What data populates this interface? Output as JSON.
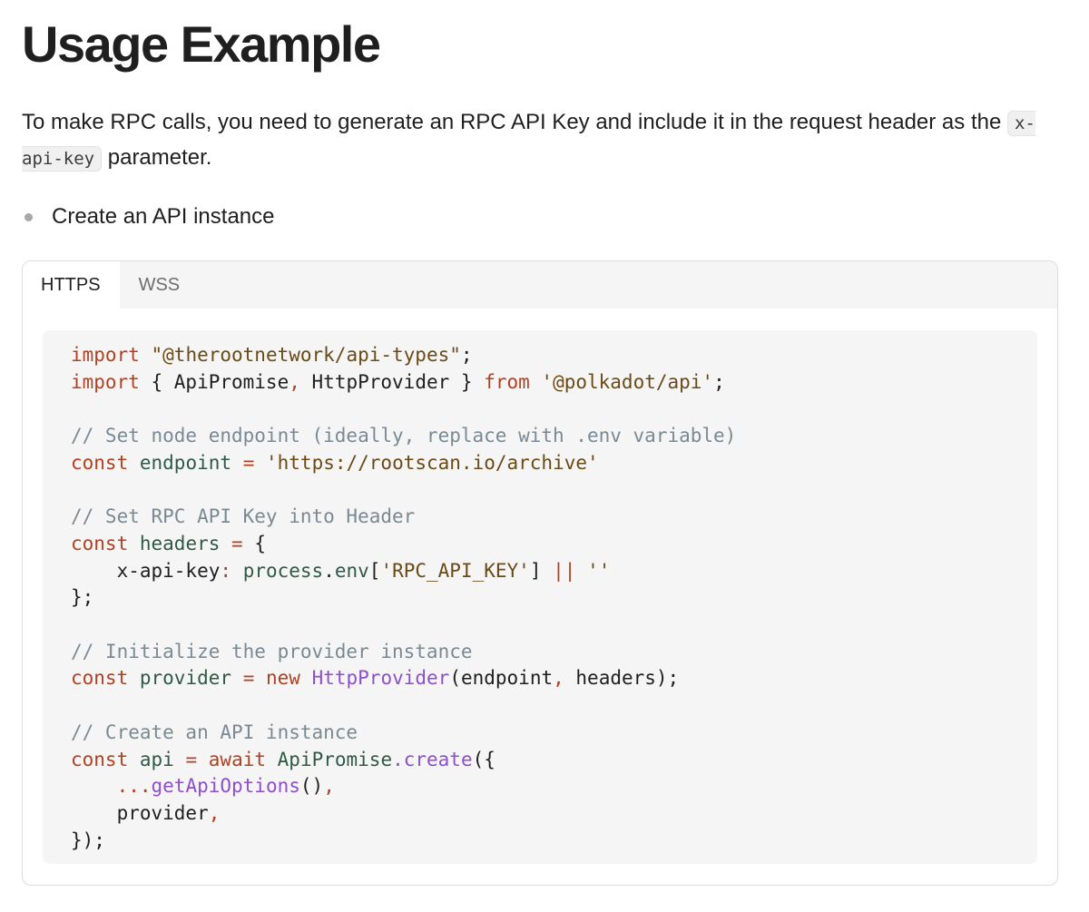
{
  "page": {
    "title": "Usage Example",
    "intro_before": "To make RPC calls, you need to generate an RPC API Key and include it in the request header as the ",
    "intro_code": "x-api-key",
    "intro_after": " parameter.",
    "bullets": [
      "Create an API instance"
    ]
  },
  "tabs": [
    {
      "label": "HTTPS",
      "active": true
    },
    {
      "label": "WSS",
      "active": false
    }
  ],
  "colors": {
    "keyword": "#b3401f",
    "string": "#6b4a16",
    "comment": "#7a8a94",
    "identifier": "#2f5a47",
    "function": "#8e4fcf",
    "default": "#1f1f1f"
  },
  "code": {
    "language": "javascript",
    "lines": [
      [
        [
          "k",
          "import"
        ],
        [
          "p",
          " "
        ],
        [
          "s",
          "\"@therootnetwork/api-types\""
        ],
        [
          "p",
          ";"
        ]
      ],
      [
        [
          "k",
          "import"
        ],
        [
          "p",
          " { ApiPromise"
        ],
        [
          "k",
          ","
        ],
        [
          "p",
          " HttpProvider } "
        ],
        [
          "k",
          "from"
        ],
        [
          "p",
          " "
        ],
        [
          "s",
          "'@polkadot/api'"
        ],
        [
          "p",
          ";"
        ]
      ],
      [],
      [
        [
          "c",
          "// Set node endpoint (ideally, replace with .env variable)"
        ]
      ],
      [
        [
          "k",
          "const"
        ],
        [
          "p",
          " "
        ],
        [
          "i",
          "endpoint"
        ],
        [
          "p",
          " "
        ],
        [
          "k",
          "="
        ],
        [
          "p",
          " "
        ],
        [
          "s",
          "'https://rootscan.io/archive'"
        ]
      ],
      [],
      [
        [
          "c",
          "// Set RPC API Key into Header"
        ]
      ],
      [
        [
          "k",
          "const"
        ],
        [
          "p",
          " "
        ],
        [
          "i",
          "headers"
        ],
        [
          "p",
          " "
        ],
        [
          "k",
          "="
        ],
        [
          "p",
          " {"
        ]
      ],
      [
        [
          "p",
          "    x-api-key"
        ],
        [
          "k",
          ":"
        ],
        [
          "p",
          " "
        ],
        [
          "i",
          "process"
        ],
        [
          "p",
          "."
        ],
        [
          "i",
          "env"
        ],
        [
          "p",
          "["
        ],
        [
          "s",
          "'RPC_API_KEY'"
        ],
        [
          "p",
          "] "
        ],
        [
          "k",
          "||"
        ],
        [
          "p",
          " "
        ],
        [
          "s",
          "''"
        ]
      ],
      [
        [
          "p",
          "};"
        ]
      ],
      [],
      [
        [
          "c",
          "// Initialize the provider instance"
        ]
      ],
      [
        [
          "k",
          "const"
        ],
        [
          "p",
          " "
        ],
        [
          "i",
          "provider"
        ],
        [
          "p",
          " "
        ],
        [
          "k",
          "="
        ],
        [
          "p",
          " "
        ],
        [
          "k",
          "new"
        ],
        [
          "p",
          " "
        ],
        [
          "f",
          "HttpProvider"
        ],
        [
          "p",
          "(endpoint"
        ],
        [
          "k",
          ","
        ],
        [
          "p",
          " headers);"
        ]
      ],
      [],
      [
        [
          "c",
          "// Create an API instance"
        ]
      ],
      [
        [
          "k",
          "const"
        ],
        [
          "p",
          " "
        ],
        [
          "i",
          "api"
        ],
        [
          "p",
          " "
        ],
        [
          "k",
          "="
        ],
        [
          "p",
          " "
        ],
        [
          "k",
          "await"
        ],
        [
          "p",
          " "
        ],
        [
          "i",
          "ApiPromise"
        ],
        [
          "f",
          ".create"
        ],
        [
          "p",
          "({"
        ]
      ],
      [
        [
          "p",
          "    "
        ],
        [
          "k",
          "..."
        ],
        [
          "f",
          "getApiOptions"
        ],
        [
          "p",
          "()"
        ],
        [
          "k",
          ","
        ]
      ],
      [
        [
          "p",
          "    provider"
        ],
        [
          "k",
          ","
        ]
      ],
      [
        [
          "p",
          "});"
        ]
      ]
    ]
  }
}
